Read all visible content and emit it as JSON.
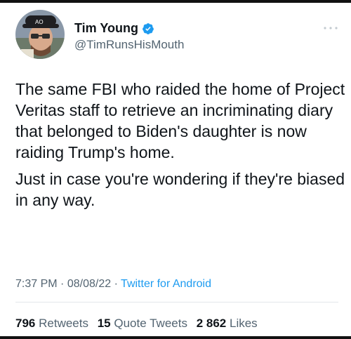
{
  "tweet": {
    "author": {
      "display_name": "Tim Young",
      "handle": "@TimRunsHisMouth",
      "verified": true,
      "avatar_icon": "avatar-photo"
    },
    "more_icon": "more-options-icon",
    "paragraphs": [
      "The same FBI who raided the home of Project Veritas staff to retrieve an incriminating diary that belonged to Biden's daughter is now raiding Trump's home.",
      "Just in case you're wondering if they're biased in any way."
    ],
    "meta": {
      "time": "7:37 PM",
      "separator": "·",
      "date": "08/08/22",
      "source": "Twitter for Android"
    },
    "stats": {
      "retweets_count": "796",
      "retweets_label": "Retweets",
      "quotes_count": "15",
      "quotes_label": "Quote Tweets",
      "likes_count": "2 862",
      "likes_label": "Likes"
    }
  },
  "colors": {
    "text": "#0f1419",
    "muted": "#536471",
    "link": "#1d9bf0",
    "verified": "#1d9bf0"
  }
}
